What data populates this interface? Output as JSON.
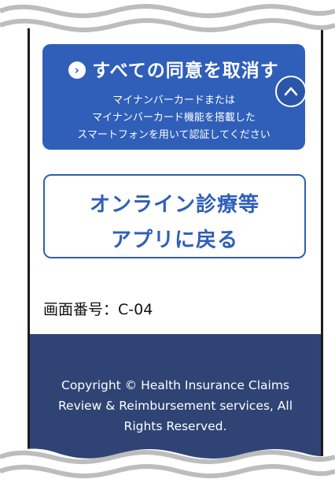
{
  "consent": {
    "revoke_all_label": "すべての同意を取消す",
    "revoke_desc_lines": [
      "マイナンバーカードまたは",
      "マイナンバーカード機能を搭載した",
      "スマートフォンを用いて認証してください"
    ]
  },
  "back_button": {
    "lines": [
      "オンライン診療等",
      "アプリに戻る"
    ]
  },
  "screen_number": "画面番号：C-04",
  "footer": {
    "copyright_lines": [
      "Copyright © Health Insurance Claims",
      "Review & Reimbursement services, All",
      "Rights Reserved."
    ]
  },
  "colors": {
    "primary": "#2f5fb8",
    "footer_bg": "#2f4474",
    "text": "#111111",
    "background": "#ffffff"
  },
  "icons": {
    "revoke_arrow": "chevron-right-icon",
    "scroll_top": "chevron-up-icon"
  }
}
